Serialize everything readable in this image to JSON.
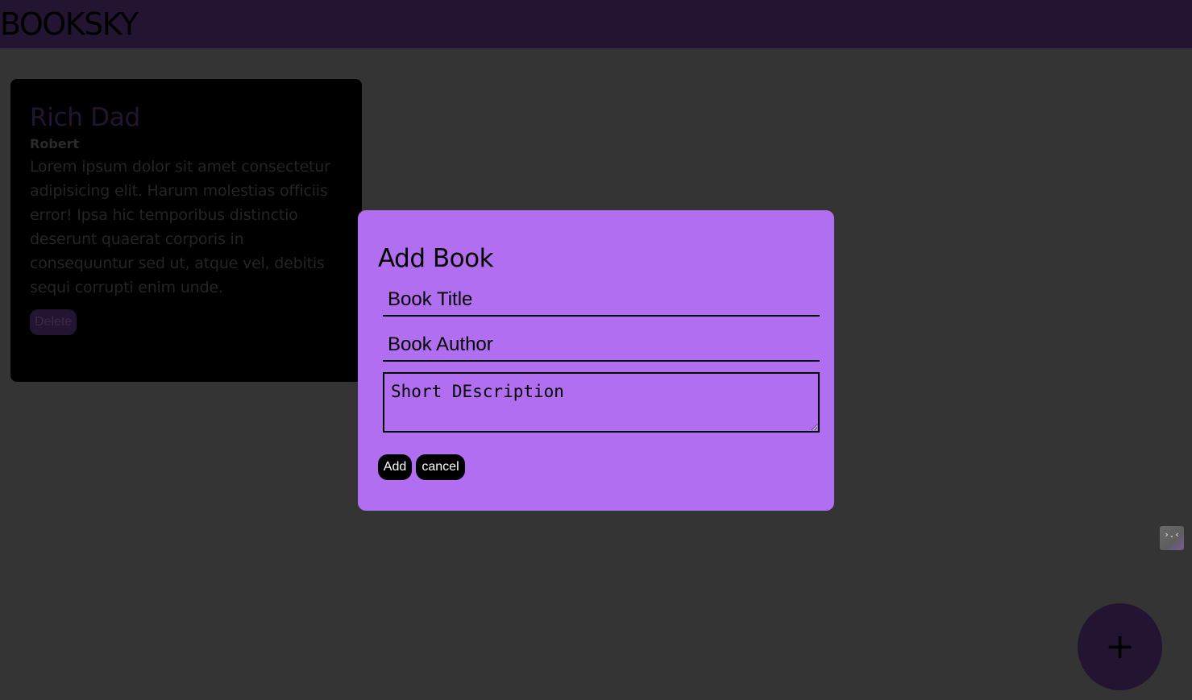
{
  "header": {
    "logo": "BOOKSKY"
  },
  "books": [
    {
      "title": "Rich Dad",
      "author": "Robert",
      "description": "Lorem ipsum dolor sit amet consectetur adipisicing elit. Harum molestias officiis error! Ipsa hic temporibus distinctio deserunt quaerat corporis in consequuntur sed ut, atque vel, debitis sequi corrupti enim unde.",
      "delete_label": "Delete"
    }
  ],
  "modal": {
    "title": "Add Book",
    "title_placeholder": "Book Title",
    "author_placeholder": "Book Author",
    "description_placeholder": "Short DEscription",
    "add_label": "Add",
    "cancel_label": "cancel"
  },
  "extension_icon": {
    "icon": "terminal-face-icon",
    "glyph": "›.‹"
  },
  "fab": {
    "icon": "plus-icon",
    "glyph": "+"
  },
  "colors": {
    "background": "#343434",
    "header": "#231531",
    "modal": "#b26ef0",
    "card": "#000000"
  }
}
